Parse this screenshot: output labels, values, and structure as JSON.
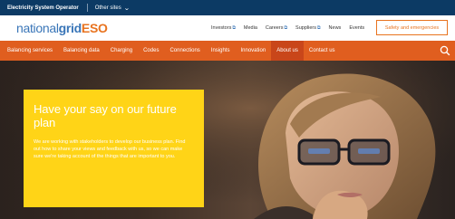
{
  "topbar": {
    "site_name": "Electricity System Operator",
    "other_sites_label": "Other sites"
  },
  "header": {
    "logo_national": "national",
    "logo_grid": "grid",
    "logo_eso": "ESO",
    "util_links": [
      {
        "label": "Investors",
        "external": true
      },
      {
        "label": "Media",
        "external": false
      },
      {
        "label": "Careers",
        "external": true
      },
      {
        "label": "Suppliers",
        "external": true
      },
      {
        "label": "News",
        "external": false
      },
      {
        "label": "Events",
        "external": false
      }
    ],
    "external_marker": "⧉",
    "safety_button_label": "Safety and emergencies"
  },
  "nav": {
    "items": [
      {
        "label": "Balancing services"
      },
      {
        "label": "Balancing data"
      },
      {
        "label": "Charging"
      },
      {
        "label": "Codes"
      },
      {
        "label": "Connections"
      },
      {
        "label": "Insights"
      },
      {
        "label": "Innovation"
      },
      {
        "label": "About us",
        "active": true
      },
      {
        "label": "Contact us"
      }
    ]
  },
  "hero": {
    "headline": "Have your say on our future plan",
    "body": "We are working with stakeholders to develop our business plan. Find out how to share your views and feedback with us, so we can make sure we're taking account of the things that are important to you."
  },
  "colors": {
    "topbar_bg": "#0c3a64",
    "nav_bg": "#e05e1f",
    "nav_active_bg": "#c9461a",
    "brand_blue": "#3a76b8",
    "brand_orange": "#e8731f",
    "promo_yellow": "#ffd417"
  },
  "icons": {
    "other_sites_chevron": "chevron-down-icon",
    "nav_search": "search-icon"
  }
}
